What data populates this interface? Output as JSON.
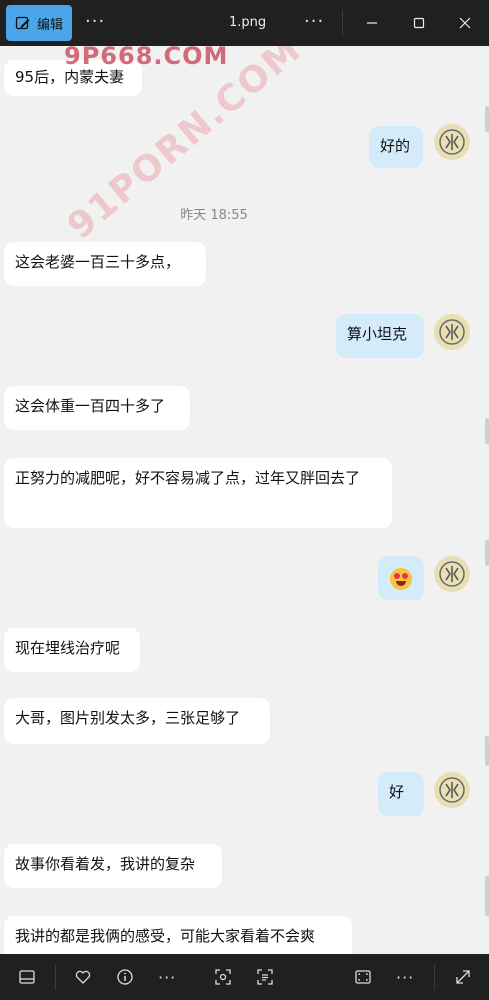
{
  "toolbar": {
    "edit_label": "编辑",
    "more_label": "···",
    "file_name": "1.png",
    "more2_label": "···"
  },
  "chat": {
    "timestamp": "昨天 18:55",
    "messages": [
      {
        "side": "left",
        "text": "95后，内蒙夫妻"
      },
      {
        "side": "right",
        "text": "好的"
      },
      {
        "side": "left",
        "text": "这会老婆一百三十多点，"
      },
      {
        "side": "right",
        "text": "算小坦克"
      },
      {
        "side": "left",
        "text": "这会体重一百四十多了"
      },
      {
        "side": "left",
        "text": "正努力的减肥呢，好不容易减了点，过年又胖回去了"
      },
      {
        "side": "right",
        "text": "",
        "emoji": "star-struck"
      },
      {
        "side": "left",
        "text": "现在埋线治疗呢"
      },
      {
        "side": "left",
        "text": "大哥，图片别发太多，三张足够了"
      },
      {
        "side": "right",
        "text": "好"
      },
      {
        "side": "left",
        "text": "故事你看着发，我讲的复杂"
      },
      {
        "side": "left",
        "text": "我讲的都是我俩的感受，可能大家看着不会爽"
      }
    ]
  },
  "watermarks": {
    "top": "9P668.COM",
    "diagonal": "91PORN.COM"
  },
  "bottombar": {
    "more_label": "···",
    "more2_label": "···"
  },
  "colors": {
    "accent": "#4aa6e8",
    "bubble_self": "#d4ebfa",
    "bubble_other": "#ffffff",
    "chrome": "#202020"
  }
}
